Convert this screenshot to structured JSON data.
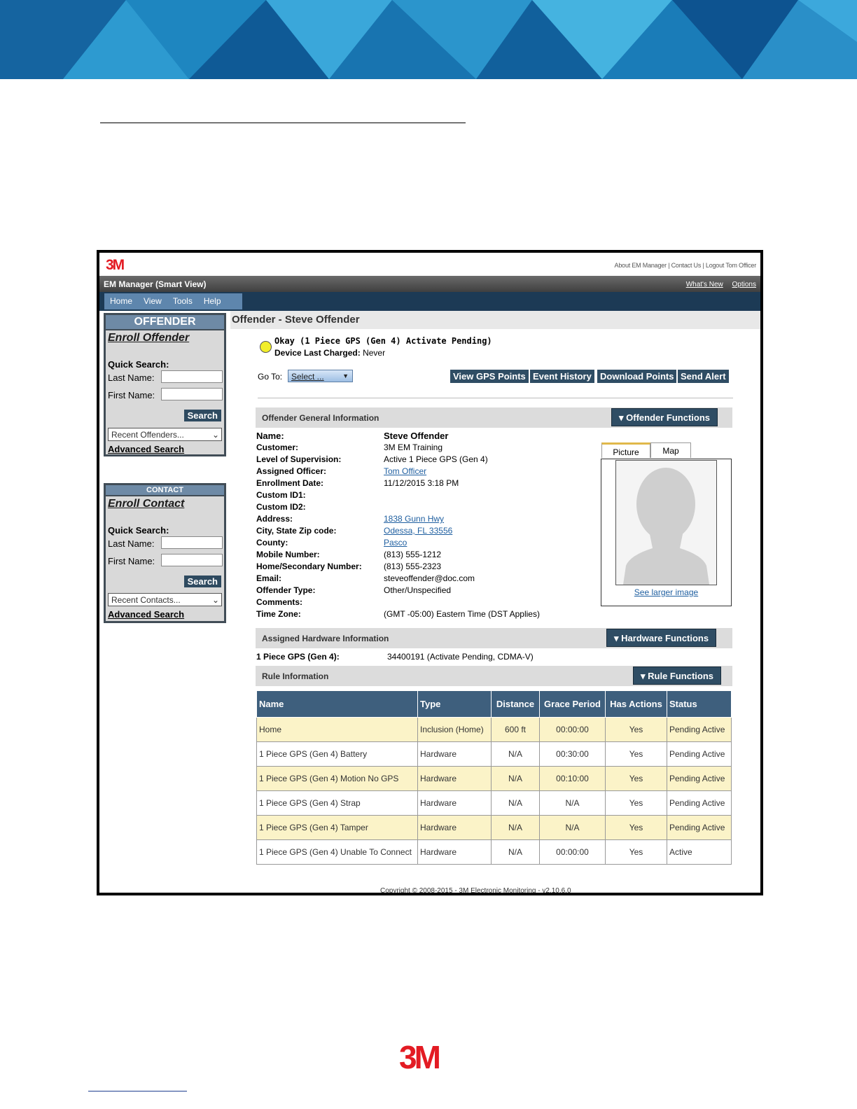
{
  "document": {
    "footer_logo_text": "3M"
  },
  "app": {
    "brand_logo_text": "3M",
    "top_links": "About EM Manager | Contact Us | Logout Tom Officer",
    "window_title": "EM Manager (Smart View)",
    "whats_new": "What's New",
    "options": "Options",
    "menu": [
      "Home",
      "View",
      "Tools",
      "Help"
    ]
  },
  "sidebar": {
    "offender": {
      "header": "OFFENDER",
      "enroll": "Enroll Offender",
      "quick_search": "Quick Search:",
      "last_name_label": "Last Name:",
      "first_name_label": "First Name:",
      "search_button": "Search",
      "recent": "Recent Offenders...",
      "advanced": "Advanced Search"
    },
    "contact": {
      "header": "CONTACT",
      "enroll": "Enroll Contact",
      "quick_search": "Quick Search:",
      "last_name_label": "Last Name:",
      "first_name_label": "First Name:",
      "search_button": "Search",
      "recent": "Recent Contacts...",
      "advanced": "Advanced Search"
    }
  },
  "main": {
    "title": "Offender - Steve Offender",
    "status_line": "Okay (1 Piece GPS (Gen 4) Activate Pending)",
    "device_charged_label": "Device Last Charged:",
    "device_charged_value": "Never",
    "status_color": "#f2ee2a",
    "goto_label": "Go To:",
    "goto_select": "Select ...",
    "actions": [
      "View GPS Points",
      "Event History",
      "Download Points",
      "Send Alert"
    ],
    "general_section": "Offender General Information",
    "general_button": "Offender Functions",
    "fields": [
      {
        "k": "Name:",
        "v": "Steve Offender"
      },
      {
        "k": "Customer:",
        "v": "3M EM Training"
      },
      {
        "k": "Level of Supervision:",
        "v": "Active 1 Piece GPS (Gen 4)"
      },
      {
        "k": "Assigned Officer:",
        "v": "Tom Officer"
      },
      {
        "k": "Enrollment Date:",
        "v": "11/12/2015 3:18 PM"
      },
      {
        "k": "Custom ID1:",
        "v": ""
      },
      {
        "k": "Custom ID2:",
        "v": ""
      },
      {
        "k": "Address:",
        "v": "1838 Gunn Hwy"
      },
      {
        "k": "City, State Zip code:",
        "v": "Odessa, FL 33556"
      },
      {
        "k": "County:",
        "v": "Pasco"
      },
      {
        "k": "Mobile Number:",
        "v": "(813) 555-1212"
      },
      {
        "k": "Home/Secondary Number:",
        "v": "(813) 555-2323"
      },
      {
        "k": "Email:",
        "v": "steveoffender@doc.com"
      },
      {
        "k": "Offender Type:",
        "v": "Other/Unspecified"
      },
      {
        "k": "Comments:",
        "v": ""
      },
      {
        "k": "Time Zone:",
        "v": "(GMT -05:00) Eastern Time (DST Applies)"
      }
    ],
    "picture_tab": "Picture",
    "map_tab": "Map",
    "see_larger": "See larger image",
    "hardware_section": "Assigned Hardware Information",
    "hardware_button": "Hardware Functions",
    "hardware_label": "1 Piece GPS (Gen 4):",
    "hardware_value": "34400191 (Activate Pending, CDMA-V)",
    "rule_section": "Rule Information",
    "rule_button": "Rule Functions",
    "rules_columns": [
      "Name",
      "Type",
      "Distance",
      "Grace Period",
      "Has Actions",
      "Status"
    ],
    "rules": [
      [
        "Home",
        "Inclusion (Home)",
        "600 ft",
        "00:00:00",
        "Yes",
        "Pending Active"
      ],
      [
        "1 Piece GPS (Gen 4) Battery",
        "Hardware",
        "N/A",
        "00:30:00",
        "Yes",
        "Pending Active"
      ],
      [
        "1 Piece GPS (Gen 4) Motion No GPS",
        "Hardware",
        "N/A",
        "00:10:00",
        "Yes",
        "Pending Active"
      ],
      [
        "1 Piece GPS (Gen 4) Strap",
        "Hardware",
        "N/A",
        "N/A",
        "Yes",
        "Pending Active"
      ],
      [
        "1 Piece GPS (Gen 4) Tamper",
        "Hardware",
        "N/A",
        "N/A",
        "Yes",
        "Pending Active"
      ],
      [
        "1 Piece GPS (Gen 4) Unable To Connect",
        "Hardware",
        "N/A",
        "00:00:00",
        "Yes",
        "Active"
      ]
    ],
    "copyright": "Copyright © 2008-2015 - 3M Electronic Monitoring - v2.10.6.0"
  }
}
